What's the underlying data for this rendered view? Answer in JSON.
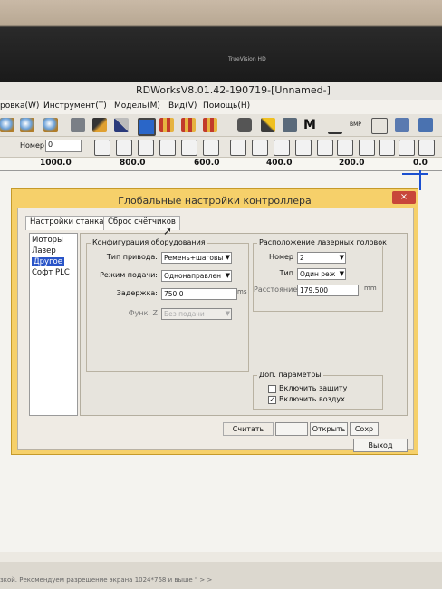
{
  "monitor": {
    "webcam_label": "TrueVision HD"
  },
  "window": {
    "title": "RDWorksV8.01.42-190719-[Unnamed-]"
  },
  "menu": {
    "items": [
      "ровка(W)",
      "Инструмент(T)",
      "Модель(M)",
      "Вид(V)",
      "Помощь(H)"
    ]
  },
  "toolbar2": {
    "number_label": "Номер",
    "number_value": "0"
  },
  "ruler": {
    "ticks": [
      "1000.0",
      "800.0",
      "600.0",
      "400.0",
      "200.0",
      "0.0"
    ]
  },
  "dialog": {
    "title": "Глобальные настройки контроллера",
    "close": "×",
    "tabs": [
      "Настройки станка",
      "Сброс счётчиков"
    ],
    "categories": [
      "Моторы",
      "Лазер",
      "Другое",
      "Софт PLC"
    ],
    "selected_category": "Другое",
    "config_group": {
      "title": "Конфигурация оборудования",
      "drive_label": "Тип привода:",
      "drive_value": "Ремень+шаговы",
      "feed_label": "Режим подачи:",
      "feed_value": "Однонаправлен",
      "delay_label": "Задержка:",
      "delay_value": "750.0",
      "delay_unit": "ms",
      "funcz_label": "Функ. Z",
      "funcz_value": "Без подачи"
    },
    "laser_group": {
      "title": "Расположение лазерных головок",
      "number_label": "Номер",
      "number_value": "2",
      "type_label": "Тип",
      "type_value": "Один реж",
      "distance_label": "Расстояние",
      "distance_value": "179.500",
      "distance_unit": "mm"
    },
    "extra_group": {
      "title": "Доп. параметры",
      "protect_label": "Включить защиту",
      "protect_checked": false,
      "air_label": "Включить воздух",
      "air_checked": true
    },
    "buttons": {
      "read": "Считать",
      "write": "",
      "open": "Открыть",
      "save": "Сохр",
      "exit": "Выход"
    }
  },
  "status": {
    "text": "зкой. Рекомендуем разрешение экрана 1024*768 и выше \" > >"
  }
}
